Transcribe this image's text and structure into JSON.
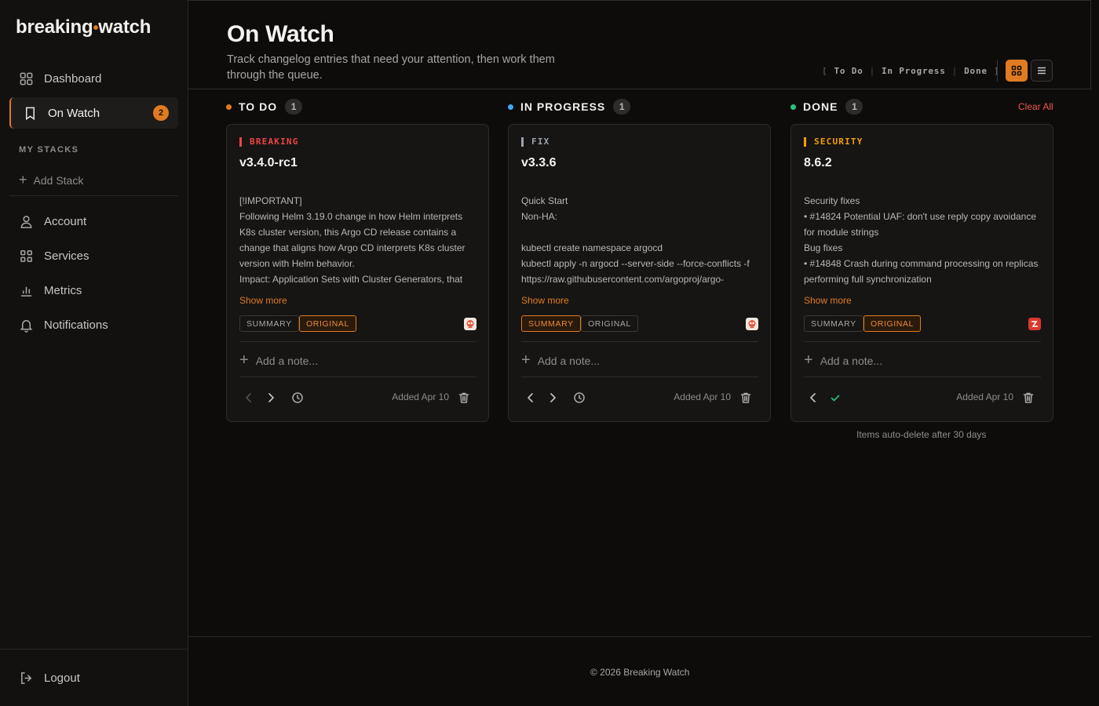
{
  "app": {
    "logo_left": "breaking",
    "logo_dot": "•",
    "logo_right": "watch",
    "accent": "#e07b22"
  },
  "sidebar": {
    "nav": [
      {
        "label": "Dashboard",
        "icon": "dashboard-icon"
      },
      {
        "label": "On Watch",
        "icon": "bookmark-icon",
        "badge": "2",
        "active": true
      }
    ],
    "stacks_label": "MY STACKS",
    "add_stack": "Add Stack",
    "account": [
      {
        "label": "Account",
        "icon": "user-icon"
      },
      {
        "label": "Services",
        "icon": "grid-icon"
      },
      {
        "label": "Metrics",
        "icon": "bar-chart-icon"
      },
      {
        "label": "Notifications",
        "icon": "bell-icon"
      }
    ],
    "logout": "Logout"
  },
  "header": {
    "title": "On Watch",
    "description": "Track changelog entries that need your attention, then work them through the queue.",
    "filters": [
      "To Do",
      "In Progress",
      "Done"
    ],
    "bracket_open": "[",
    "bracket_close": "]",
    "separator": "|"
  },
  "columns": [
    {
      "name": "TO DO",
      "count": "1",
      "dot_color": "#e07b22"
    },
    {
      "name": "IN PROGRESS",
      "count": "1",
      "dot_color": "#3fa9f5"
    },
    {
      "name": "DONE",
      "count": "1",
      "dot_color": "#2ec27e"
    }
  ],
  "clear_all": "Clear All",
  "cards": [
    {
      "tag": "BREAKING",
      "tag_color": "#ef4444",
      "version": "v3.4.0-rc1",
      "lines": [
        "[!IMPORTANT]",
        "Following Helm 3.19.0 change in how Helm interprets",
        "K8s cluster version, this Argo CD release contains a",
        "change that aligns how Argo CD interprets K8s cluster",
        "version with Helm behavior.",
        "Impact: Application Sets with Cluster Generators, that"
      ],
      "show_more": "Show more",
      "summary": "SUMMARY",
      "original": "ORIGINAL",
      "active_pill": "original",
      "source_icon": "argo-icon",
      "add_note": "Add a note...",
      "added": "Added Apr 10"
    },
    {
      "tag": "FIX",
      "tag_color": "#9ca3af",
      "version": "v3.3.6",
      "lines": [
        "Quick Start",
        "Non-HA:",
        "",
        "kubectl create namespace argocd",
        "kubectl apply -n argocd --server-side --force-conflicts -f",
        "https://raw.githubusercontent.com/argoproj/argo-"
      ],
      "show_more": "Show more",
      "summary": "SUMMARY",
      "original": "ORIGINAL",
      "active_pill": "summary",
      "source_icon": "argo-icon",
      "add_note": "Add a note...",
      "added": "Added Apr 10"
    },
    {
      "tag": "SECURITY",
      "tag_color": "#f59e0b",
      "version": "8.6.2",
      "lines": [
        "Security fixes",
        "• #14824 Potential UAF: don't use reply copy avoidance",
        "for module strings",
        "Bug fixes",
        "• #14848 Crash during command processing on replicas",
        "performing full synchronization"
      ],
      "show_more": "Show more",
      "summary": "SUMMARY",
      "original": "ORIGINAL",
      "active_pill": "original",
      "source_icon": "redis-icon",
      "add_note": "Add a note...",
      "added": "Added Apr 10"
    }
  ],
  "auto_delete": "Items auto-delete after 30 days",
  "footer": "© 2026 Breaking Watch"
}
